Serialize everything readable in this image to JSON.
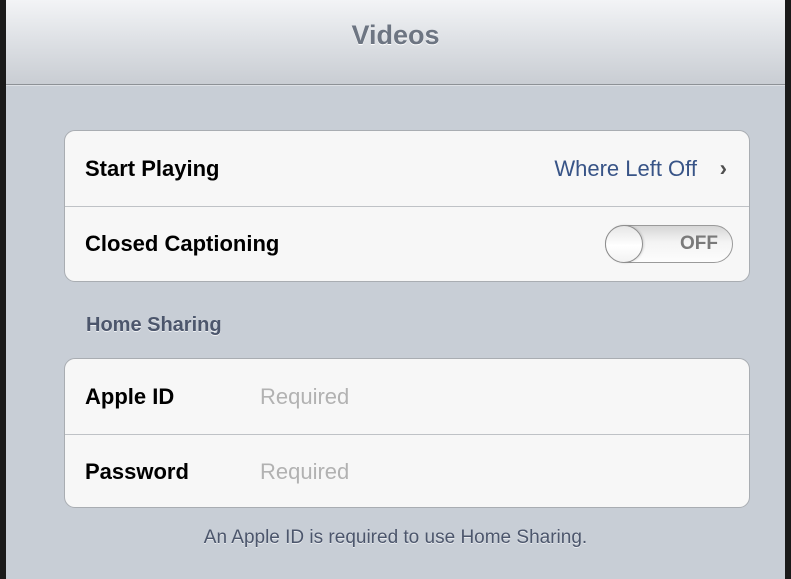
{
  "navbar": {
    "title": "Videos"
  },
  "playback_group": {
    "start_playing": {
      "label": "Start Playing",
      "value": "Where Left Off",
      "chevron_icon": "chevron-right-icon"
    },
    "closed_captioning": {
      "label": "Closed Captioning",
      "toggle_state": "OFF"
    }
  },
  "home_sharing": {
    "header": "Home Sharing",
    "apple_id": {
      "label": "Apple ID",
      "value": "",
      "placeholder": "Required"
    },
    "password": {
      "label": "Password",
      "value": "",
      "placeholder": "Required"
    },
    "footer": "An Apple ID is required to use Home Sharing."
  },
  "colors": {
    "background": "#c8ced6",
    "value_blue": "#385487",
    "section_text": "#4c566c",
    "nav_title": "#6d7582"
  }
}
